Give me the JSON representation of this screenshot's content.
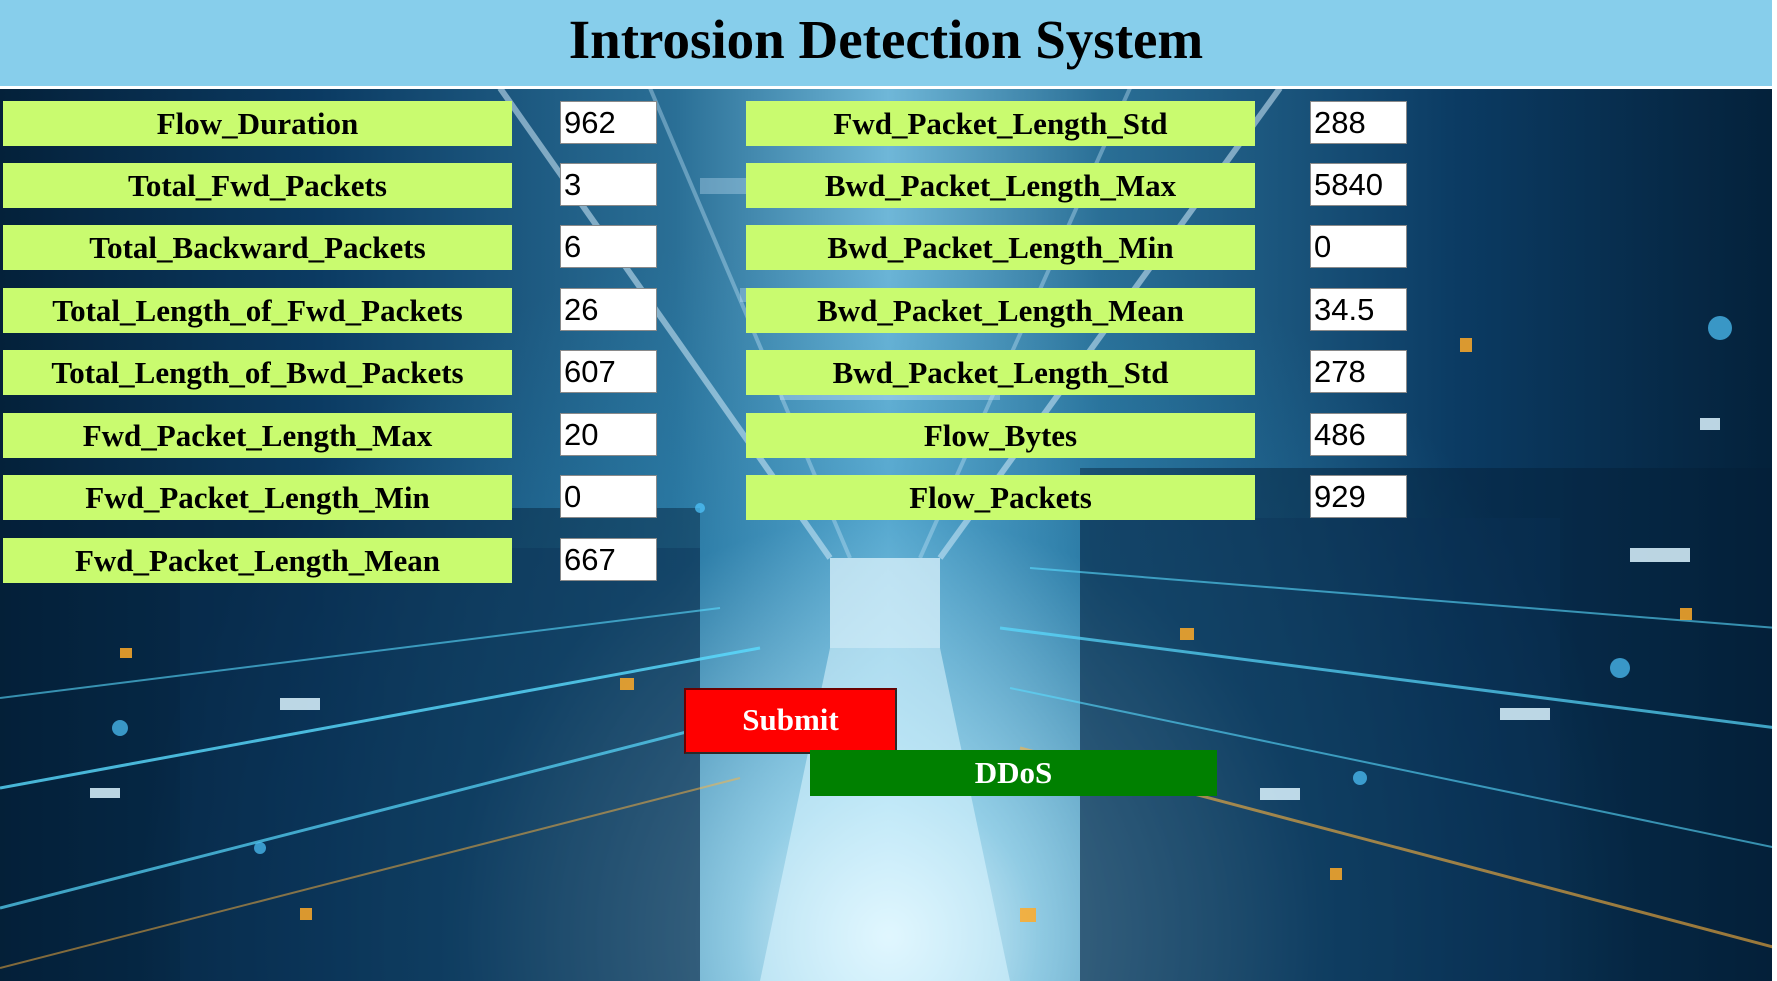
{
  "header": {
    "title": "Introsion Detection System"
  },
  "left_fields": [
    {
      "label": "Flow_Duration",
      "value": "962"
    },
    {
      "label": "Total_Fwd_Packets",
      "value": "3"
    },
    {
      "label": "Total_Backward_Packets",
      "value": "6"
    },
    {
      "label": "Total_Length_of_Fwd_Packets",
      "value": "26"
    },
    {
      "label": "Total_Length_of_Bwd_Packets",
      "value": "607"
    },
    {
      "label": "Fwd_Packet_Length_Max",
      "value": "20"
    },
    {
      "label": "Fwd_Packet_Length_Min",
      "value": "0"
    },
    {
      "label": "Fwd_Packet_Length_Mean",
      "value": "667"
    }
  ],
  "right_fields": [
    {
      "label": "Fwd_Packet_Length_Std",
      "value": "288"
    },
    {
      "label": "Bwd_Packet_Length_Max",
      "value": "5840"
    },
    {
      "label": "Bwd_Packet_Length_Min",
      "value": "0"
    },
    {
      "label": "Bwd_Packet_Length_Mean",
      "value": "34.5"
    },
    {
      "label": "Bwd_Packet_Length_Std",
      "value": "278"
    },
    {
      "label": "Flow_Bytes",
      "value": "486"
    },
    {
      "label": "Flow_Packets",
      "value": "929"
    }
  ],
  "actions": {
    "submit_label": "Submit"
  },
  "result": {
    "label": "DDoS",
    "color": "#008000"
  },
  "colors": {
    "header_bg": "#87ceeb",
    "label_bg": "#c9fb6f",
    "submit_bg": "#ff0000"
  }
}
